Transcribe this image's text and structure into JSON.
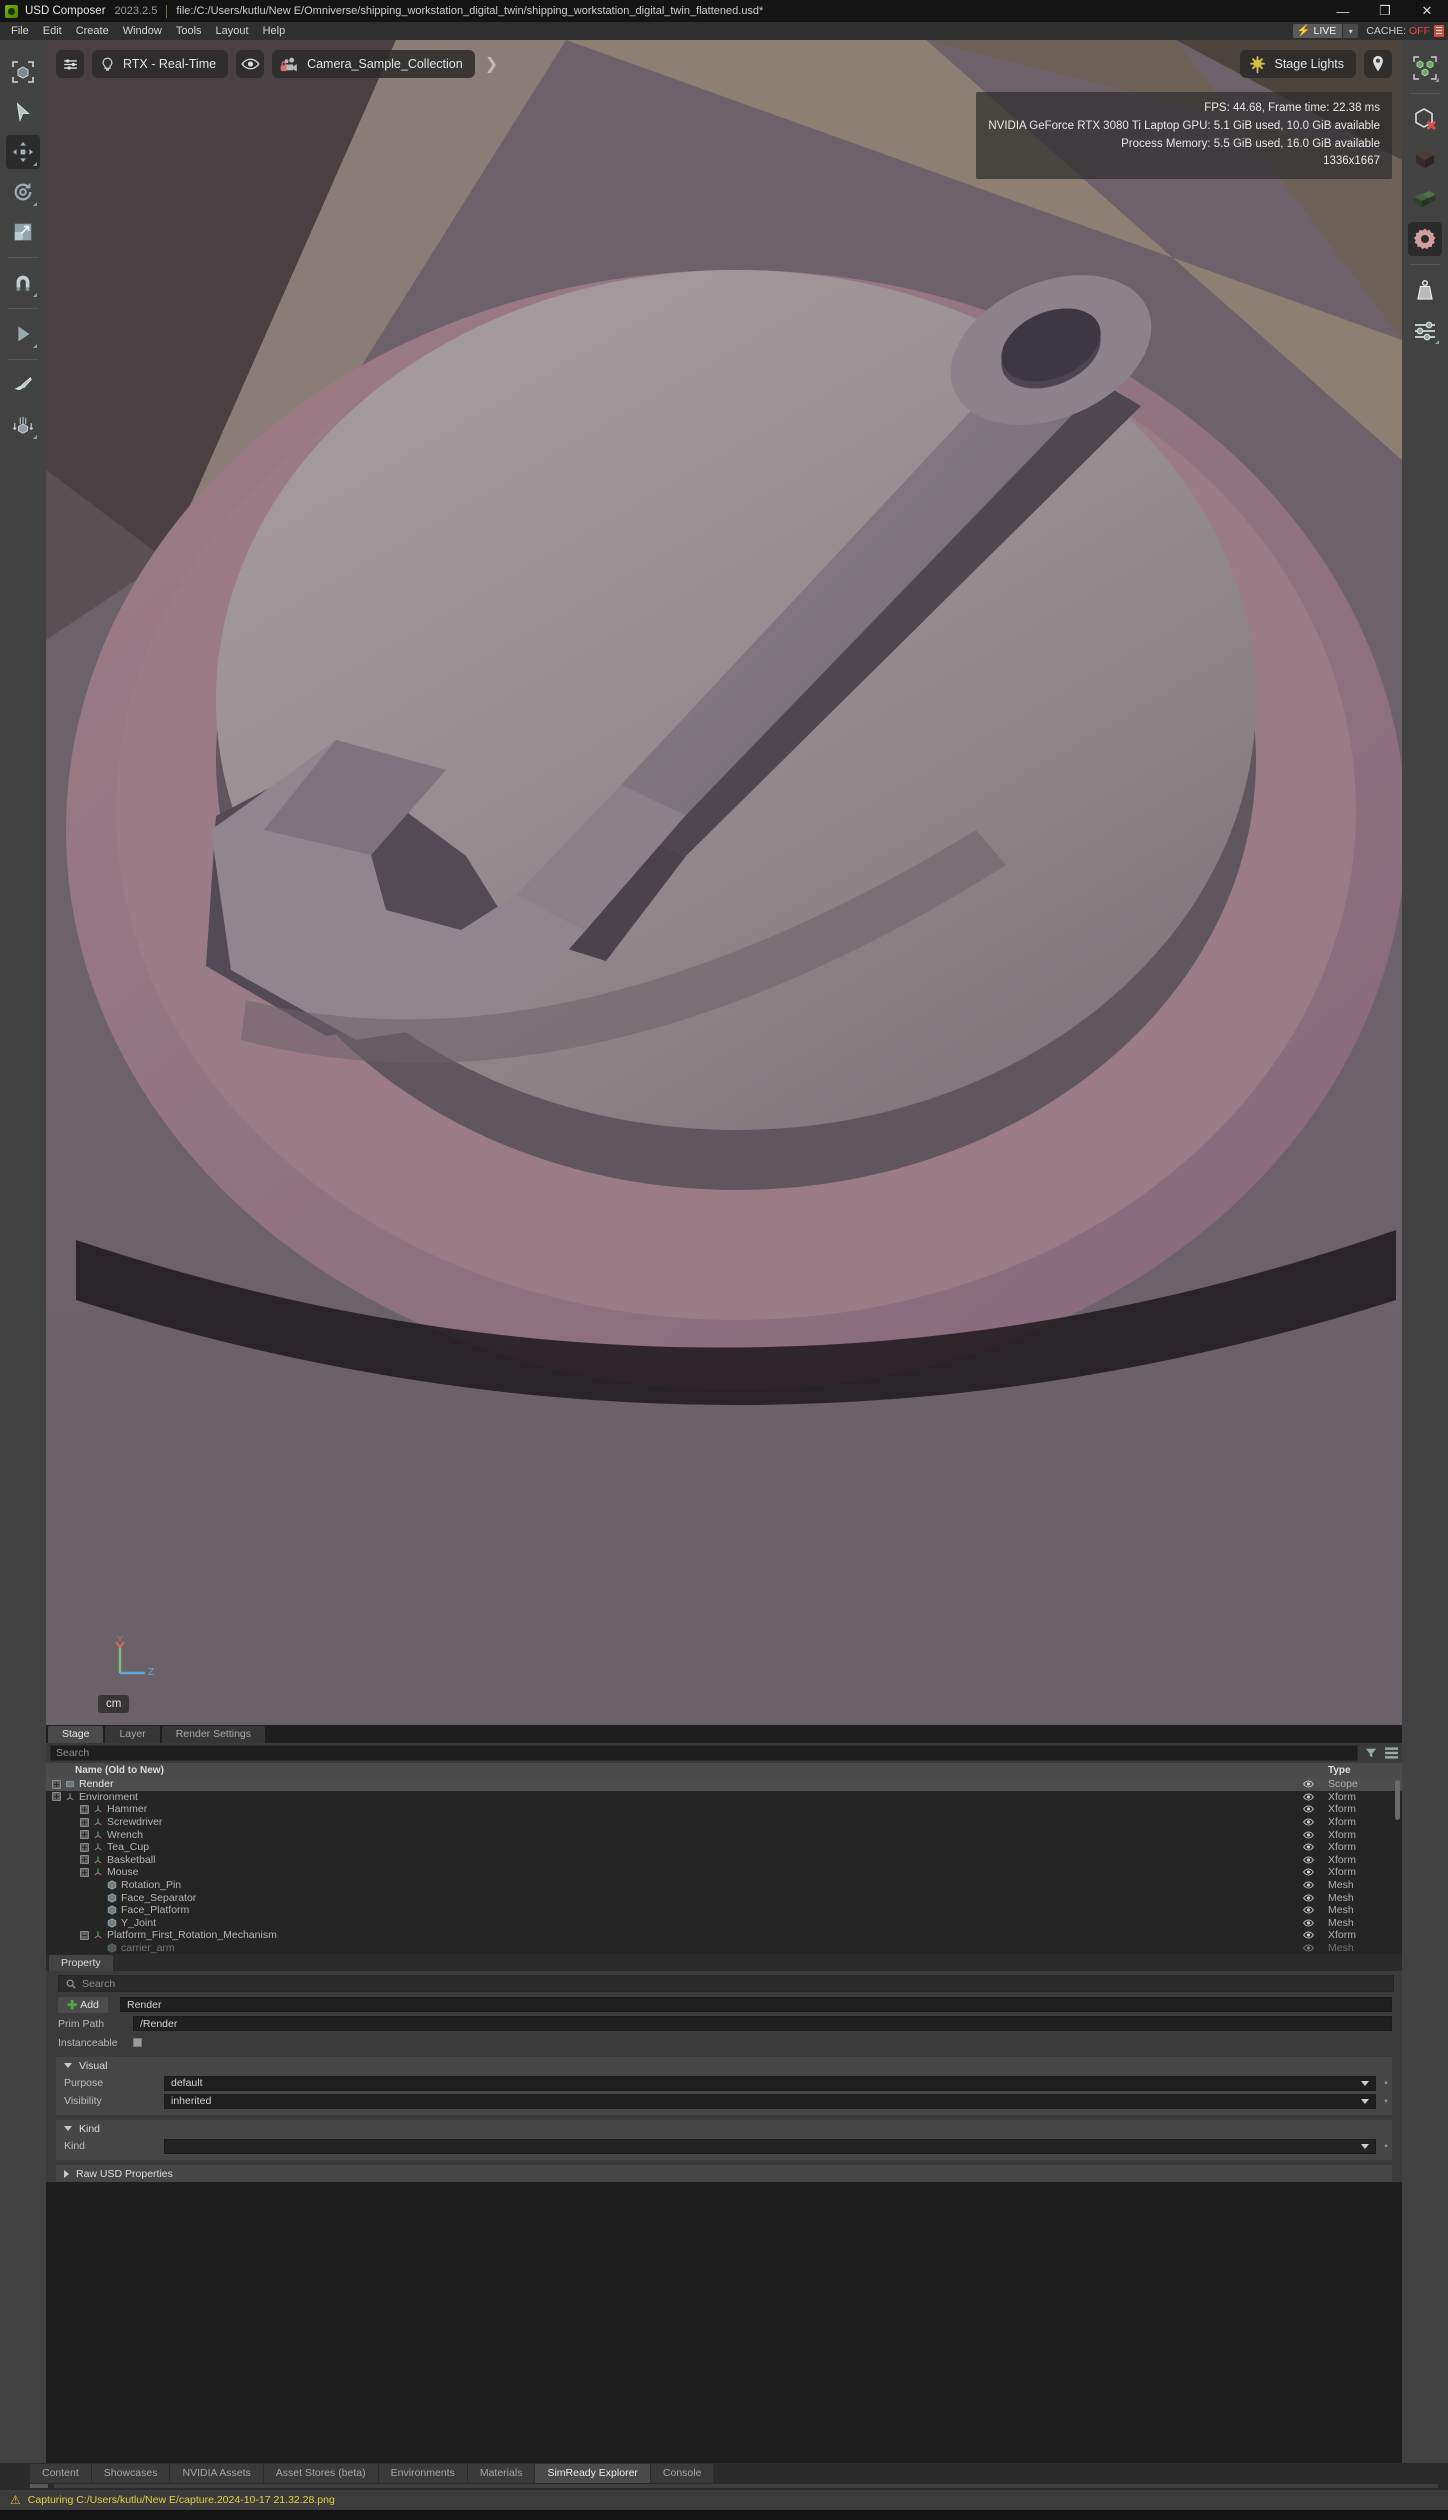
{
  "titlebar": {
    "app_name": "USD Composer",
    "version": "2023.2.5",
    "file_path": "file:/C:/Users/kutlu/New E/Omniverse/shipping_workstation_digital_twin/shipping_workstation_digital_twin_flattened.usd*",
    "minimize": "—",
    "maximize": "❐",
    "close": "✕"
  },
  "menubar": {
    "items": [
      "File",
      "Edit",
      "Create",
      "Window",
      "Tools",
      "Layout",
      "Help"
    ],
    "live_label": "LIVE",
    "live_caret": "▾",
    "cache_label": "CACHE:",
    "cache_value": "OFF"
  },
  "left_toolbar": {
    "items": [
      {
        "name": "select-bounds-tool"
      },
      {
        "name": "pointer-select-tool"
      },
      {
        "name": "move-tool"
      },
      {
        "name": "rotate-tool"
      },
      {
        "name": "scale-tool"
      },
      {
        "name": "snap-magnet-tool"
      },
      {
        "name": "play-tool"
      },
      {
        "name": "paint-brush-tool"
      },
      {
        "name": "physics-drop-tool"
      }
    ]
  },
  "right_toolbar": {
    "items": [
      {
        "name": "instance-group-icon"
      },
      {
        "name": "hide-unselected-icon"
      },
      {
        "name": "dark-cube-icon"
      },
      {
        "name": "green-cubes-icon"
      },
      {
        "name": "settings-gear-icon"
      },
      {
        "name": "weight-physics-icon"
      },
      {
        "name": "sliders-icon"
      }
    ]
  },
  "viewport": {
    "renderer_chip": "RTX - Real-Time",
    "camera_chip": "Camera_Sample_Collection",
    "lighting_chip": "Stage Lights",
    "settings_icon": "sliders-icon",
    "renderer_icon": "lightbulb-icon",
    "eye_icon": "eye-icon",
    "camera_icon": "camera-lock-icon",
    "chevron": "❯",
    "light_icon": "sun-icon",
    "pin_icon": "map-pin-icon",
    "stats": [
      "FPS: 44.68, Frame time: 22.38 ms",
      "NVIDIA GeForce RTX 3080 Ti Laptop GPU: 5.1 GiB used, 10.0 GiB available",
      "Process Memory: 5.5 GiB used, 16.0 GiB available",
      "1336x1667"
    ],
    "axis_y": "Y",
    "axis_z": "Z",
    "unit": "cm"
  },
  "stage": {
    "tabs": [
      {
        "label": "Stage",
        "active": true
      },
      {
        "label": "Layer",
        "active": false
      },
      {
        "label": "Render Settings",
        "active": false
      }
    ],
    "search_placeholder": "Search",
    "filter_icon": "filter-icon",
    "options_icon": "hamburger-menu-icon",
    "columns": {
      "name": "Name (Old to New)",
      "type": "Type"
    },
    "rows": [
      {
        "label": "carrier_arm",
        "type": "Mesh",
        "indent": 3,
        "expander": "none",
        "icon": "mesh",
        "partial": true,
        "selected": false
      },
      {
        "label": "Platform_First_Rotation_Mechanism",
        "type": "Xform",
        "indent": 2,
        "expander": "minus",
        "icon": "xform",
        "selected": false
      },
      {
        "label": "Y_Joint",
        "type": "Mesh",
        "indent": 3,
        "expander": "none",
        "icon": "mesh",
        "selected": false
      },
      {
        "label": "Face_Platform",
        "type": "Mesh",
        "indent": 3,
        "expander": "none",
        "icon": "mesh",
        "selected": false
      },
      {
        "label": "Face_Separator",
        "type": "Mesh",
        "indent": 3,
        "expander": "none",
        "icon": "mesh",
        "selected": false
      },
      {
        "label": "Rotation_Pin",
        "type": "Mesh",
        "indent": 3,
        "expander": "none",
        "icon": "mesh",
        "selected": false
      },
      {
        "label": "Mouse",
        "type": "Xform",
        "indent": 2,
        "expander": "plus",
        "icon": "xform",
        "selected": false
      },
      {
        "label": "Basketball",
        "type": "Xform",
        "indent": 2,
        "expander": "plus",
        "icon": "xform",
        "selected": false
      },
      {
        "label": "Tea_Cup",
        "type": "Xform",
        "indent": 2,
        "expander": "plus",
        "icon": "xform",
        "selected": false
      },
      {
        "label": "Wrench",
        "type": "Xform",
        "indent": 2,
        "expander": "plus",
        "icon": "xform",
        "selected": false
      },
      {
        "label": "Screwdriver",
        "type": "Xform",
        "indent": 2,
        "expander": "plus",
        "icon": "xform",
        "selected": false
      },
      {
        "label": "Hammer",
        "type": "Xform",
        "indent": 2,
        "expander": "plus",
        "icon": "xform",
        "selected": false
      },
      {
        "label": "Environment",
        "type": "Xform",
        "indent": 0,
        "expander": "plus",
        "icon": "xform",
        "selected": false
      },
      {
        "label": "Render",
        "type": "Scope",
        "indent": 0,
        "expander": "plus",
        "icon": "scope",
        "selected": true
      }
    ]
  },
  "property": {
    "tab_label": "Property",
    "search_placeholder": "Search",
    "search_icon": "search-icon",
    "add_label": "Add",
    "name_value": "Render",
    "prim_path_label": "Prim Path",
    "prim_path_value": "/Render",
    "instanceable_label": "Instanceable",
    "sections": [
      {
        "title": "Visual",
        "expanded": true,
        "fields": [
          {
            "label": "Purpose",
            "value": "default",
            "dropdown": true
          },
          {
            "label": "Visibility",
            "value": "inherited",
            "dropdown": true
          }
        ]
      },
      {
        "title": "Kind",
        "expanded": true,
        "fields": [
          {
            "label": "Kind",
            "value": "",
            "dropdown": true
          }
        ]
      }
    ],
    "raw_section_title": "Raw USD Properties"
  },
  "bottom_tabs": [
    {
      "label": "Content",
      "active": false
    },
    {
      "label": "Showcases",
      "active": false
    },
    {
      "label": "NVIDIA Assets",
      "active": false
    },
    {
      "label": "Asset Stores (beta)",
      "active": false
    },
    {
      "label": "Environments",
      "active": false
    },
    {
      "label": "Materials",
      "active": false
    },
    {
      "label": "SimReady Explorer",
      "active": true
    },
    {
      "label": "Console",
      "active": false
    }
  ],
  "statusbar": {
    "warning_icon": "warning-triangle-icon",
    "message": "Capturing C:/Users/kutlu/New E/capture.2024-10-17 21.32.28.png"
  },
  "colors": {
    "accent_green": "#76b900",
    "live_yellow": "#ffd21e",
    "cache_red": "#e04a4a",
    "status_yellow": "#e0d23a",
    "selection": "#4c4c4c"
  }
}
